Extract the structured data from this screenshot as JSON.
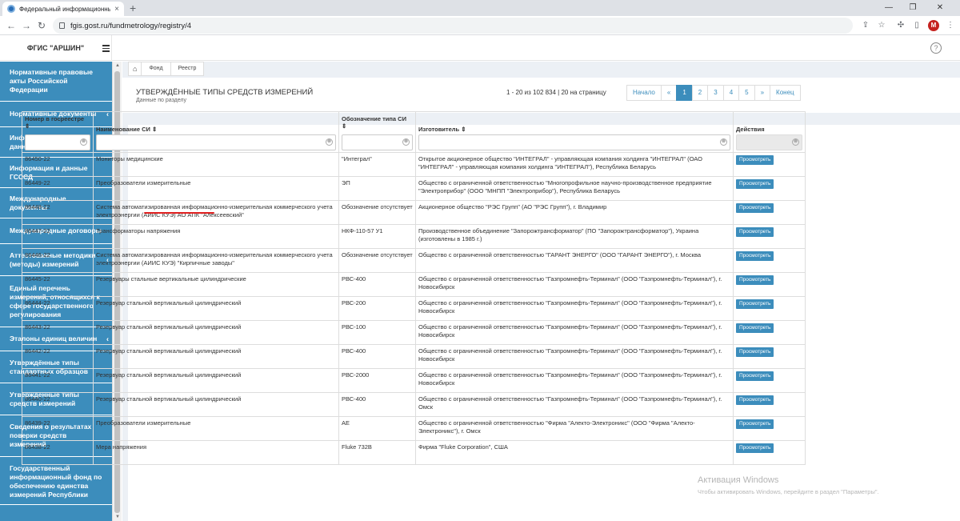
{
  "browser": {
    "tab_title": "Федеральный информационный",
    "tab_close": "×",
    "new_tab": "+",
    "url": "fgis.gost.ru/fundmetrology/registry/4",
    "avatar": "M",
    "window_min": "—",
    "window_max": "❐",
    "window_close": "✕"
  },
  "app": {
    "brand": "ФГИС \"АРШИН\"",
    "help": "?"
  },
  "sidebar": {
    "items": [
      {
        "label": "Нормативные правовые акты Российской Федерации",
        "chevron": ""
      },
      {
        "label": "Нормативные документы",
        "chevron": "‹"
      },
      {
        "label": "Информационные базы данных",
        "chevron": "‹"
      },
      {
        "label": "Информация и данные ГСССД",
        "chevron": ""
      },
      {
        "label": "Международные документы",
        "chevron": ""
      },
      {
        "label": "Международные договоры",
        "chevron": ""
      },
      {
        "label": "Аттестованные методики (методы) измерений",
        "chevron": "‹"
      },
      {
        "label": "Единый перечень измерений, относящихся к сфере государственного регулирования",
        "chevron": ""
      },
      {
        "label": "Эталоны единиц величин",
        "chevron": "‹"
      },
      {
        "label": "Утверждённые типы стандартных образцов",
        "chevron": ""
      },
      {
        "label": "Утверждённые типы средств измерений",
        "chevron": ""
      },
      {
        "label": "Сведения о результатах поверки средств измерений",
        "chevron": ""
      },
      {
        "label": "Государственный информационный фонд по обеспечению единства измерений Республики",
        "chevron": ""
      }
    ]
  },
  "breadcrumb": {
    "home": "⌂",
    "items": [
      "Фонд",
      "Реестр"
    ]
  },
  "page": {
    "title": "УТВЕРЖДЁННЫЕ ТИПЫ СРЕДСТВ ИЗМЕРЕНИЙ",
    "subtitle": "Данные по разделу"
  },
  "pagination": {
    "info": "1 - 20 из 102 834 | 20 на страницу",
    "first": "Начало",
    "prev": "«",
    "pages": [
      "1",
      "2",
      "3",
      "4",
      "5"
    ],
    "active_page": "1",
    "next": "»",
    "last": "Конец"
  },
  "table": {
    "columns": [
      {
        "label": "Номер в госреестре",
        "sort": "⇕"
      },
      {
        "label": "Наименование СИ",
        "sort": "⇕"
      },
      {
        "label": "Обозначение типа СИ",
        "sort": "⇕"
      },
      {
        "label": "Изготовитель",
        "sort": "⇕"
      },
      {
        "label": "Действия",
        "sort": ""
      }
    ],
    "filter_clear": "⊗",
    "view_label": "Просмотреть",
    "rows": [
      {
        "num": "86450-22",
        "name": "Мониторы медицинские",
        "type": "\"Интеграл\"",
        "maker": "Открытое акционерное общество \"ИНТЕГРАЛ\" - управляющая компания холдинга \"ИНТЕГРАЛ\" (ОАО \"ИНТЕГРАЛ\" - управляющая компания холдинга \"ИНТЕГРАЛ\"), Республика Беларусь"
      },
      {
        "num": "86449-22",
        "name": "Преобразователи измерительные",
        "type": "ЭП",
        "maker": "Общество с ограниченной ответственностью \"Многопрофильное научно-производственное предприятие \"Электроприбор\" (ООО \"МНПП \"Электроприбор\"), Республика Беларусь"
      },
      {
        "num": "86448-22",
        "name": "Система автоматизированная информационно-измерительная коммерческого учета электроэнергии (АИИС КУЭ) АО АПК \"Алексеевский\"",
        "type": "Обозначение отсутствует",
        "maker": "Акционерное общество \"РЭС Групп\" (АО \"РЭС Групп\"), г. Владимир"
      },
      {
        "num": "86447-22",
        "name": "Трансформаторы напряжения",
        "type": "НКФ-110-57 У1",
        "maker": "Производственное объединение \"Запорожтрансформатор\" (ПО \"Запорожтрансформатор\"), Украина (изготовлены в 1985 г.)"
      },
      {
        "num": "86446-22",
        "name": "Система автоматизированная информационно-измерительная коммерческого учета электроэнергии (АИИС КУЭ) \"Кирпичные заводы\"",
        "type": "Обозначение отсутствует",
        "maker": "Общество с ограниченной ответственностью \"ГАРАНТ ЭНЕРГО\" (ООО \"ГАРАНТ ЭНЕРГО\"), г. Москва"
      },
      {
        "num": "86445-22",
        "name": "Резервуары стальные вертикальные цилиндрические",
        "type": "РВС-400",
        "maker": "Общество с ограниченной ответственностью \"Газпромнефть-Терминал\" (ООО \"Газпромнефть-Терминал\"), г. Новосибирск"
      },
      {
        "num": "86444-22",
        "name": "Резервуар стальной вертикальный цилиндрический",
        "type": "РВС-200",
        "maker": "Общество с ограниченной ответственностью \"Газпромнефть-Терминал\" (ООО \"Газпромнефть-Терминал\"), г. Новосибирск"
      },
      {
        "num": "86443-22",
        "name": "Резервуар стальной вертикальный цилиндрический",
        "type": "РВС-100",
        "maker": "Общество с ограниченной ответственностью \"Газпромнефть-Терминал\" (ООО \"Газпромнефть-Терминал\"), г. Новосибирск"
      },
      {
        "num": "86442-22",
        "name": "Резервуар стальной вертикальный цилиндрический",
        "type": "РВС-400",
        "maker": "Общество с ограниченной ответственностью \"Газпромнефть-Терминал\" (ООО \"Газпромнефть-Терминал\"), г. Новосибирск"
      },
      {
        "num": "86441-22",
        "name": "Резервуар стальной вертикальный цилиндрический",
        "type": "РВС-2000",
        "maker": "Общество с ограниченной ответственностью \"Газпромнефть-Терминал\" (ООО \"Газпромнефть-Терминал\"), г. Новосибирск"
      },
      {
        "num": "86440-22",
        "name": "Резервуар стальной вертикальный цилиндрический",
        "type": "РВС-400",
        "maker": "Общество с ограниченной ответственностью \"Газпромнефть-Терминал\" (ООО \"Газпромнефть-Терминал\"), г. Омск"
      },
      {
        "num": "86439-22",
        "name": "Преобразователи измерительные",
        "type": "АЕ",
        "maker": "Общество с ограниченной ответственностью \"Фирма \"Алекто-Электроникс\" (ООО \"Фирма \"Алекто-Электроникс\"), г. Омск"
      },
      {
        "num": "86438-22",
        "name": "Мера напряжения",
        "type": "Fluke 732B",
        "maker": "Фирма \"Fluke Corporation\", США"
      }
    ]
  },
  "watermark": {
    "line1": "Активация Windows",
    "line2": "Чтобы активировать Windows, перейдите в раздел \"Параметры\"."
  },
  "colors": {
    "sidebar_bg": "#3c8dbc",
    "accent": "#3c8dbc",
    "highlight_underline": "#e02020"
  }
}
